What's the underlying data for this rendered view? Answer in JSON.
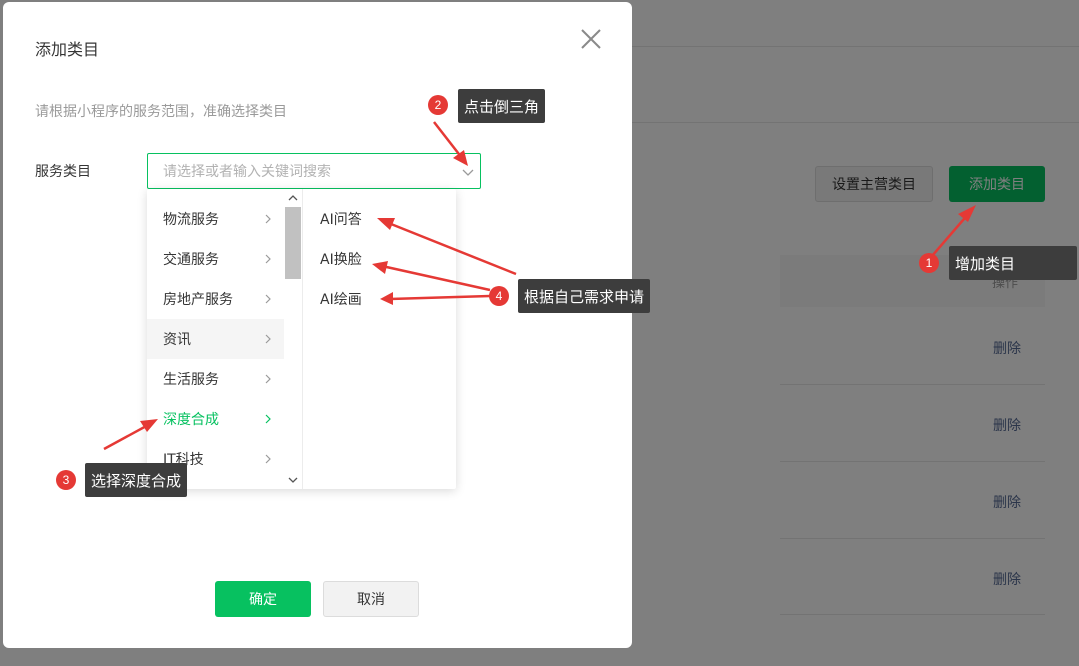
{
  "background": {
    "set_main_category_label": "设置主营类目",
    "add_category_label": "添加类目",
    "table_header_action": "操作",
    "delete_label": "删除"
  },
  "modal": {
    "title": "添加类目",
    "description": "请根据小程序的服务范围，准确选择类目",
    "field_label": "服务类目",
    "select_placeholder": "请选择或者输入关键词搜索",
    "categories": [
      {
        "label": "物流服务"
      },
      {
        "label": "交通服务"
      },
      {
        "label": "房地产服务"
      },
      {
        "label": "资讯"
      },
      {
        "label": "生活服务"
      },
      {
        "label": "深度合成"
      },
      {
        "label": "IT科技"
      }
    ],
    "active_category": "深度合成",
    "subcategories": [
      {
        "label": "AI问答"
      },
      {
        "label": "AI换脸"
      },
      {
        "label": "AI绘画"
      }
    ],
    "confirm_label": "确定",
    "cancel_label": "取消"
  },
  "annotations": [
    {
      "number": "1",
      "text": "增加类目"
    },
    {
      "number": "2",
      "text": "点击倒三角"
    },
    {
      "number": "3",
      "text": "选择深度合成"
    },
    {
      "number": "4",
      "text": "根据自己需求申请"
    }
  ],
  "colors": {
    "accent": "#07c160",
    "link": "#576b95",
    "annotation_arrow": "#e53935",
    "annotation_box": "#3d3d3d"
  }
}
